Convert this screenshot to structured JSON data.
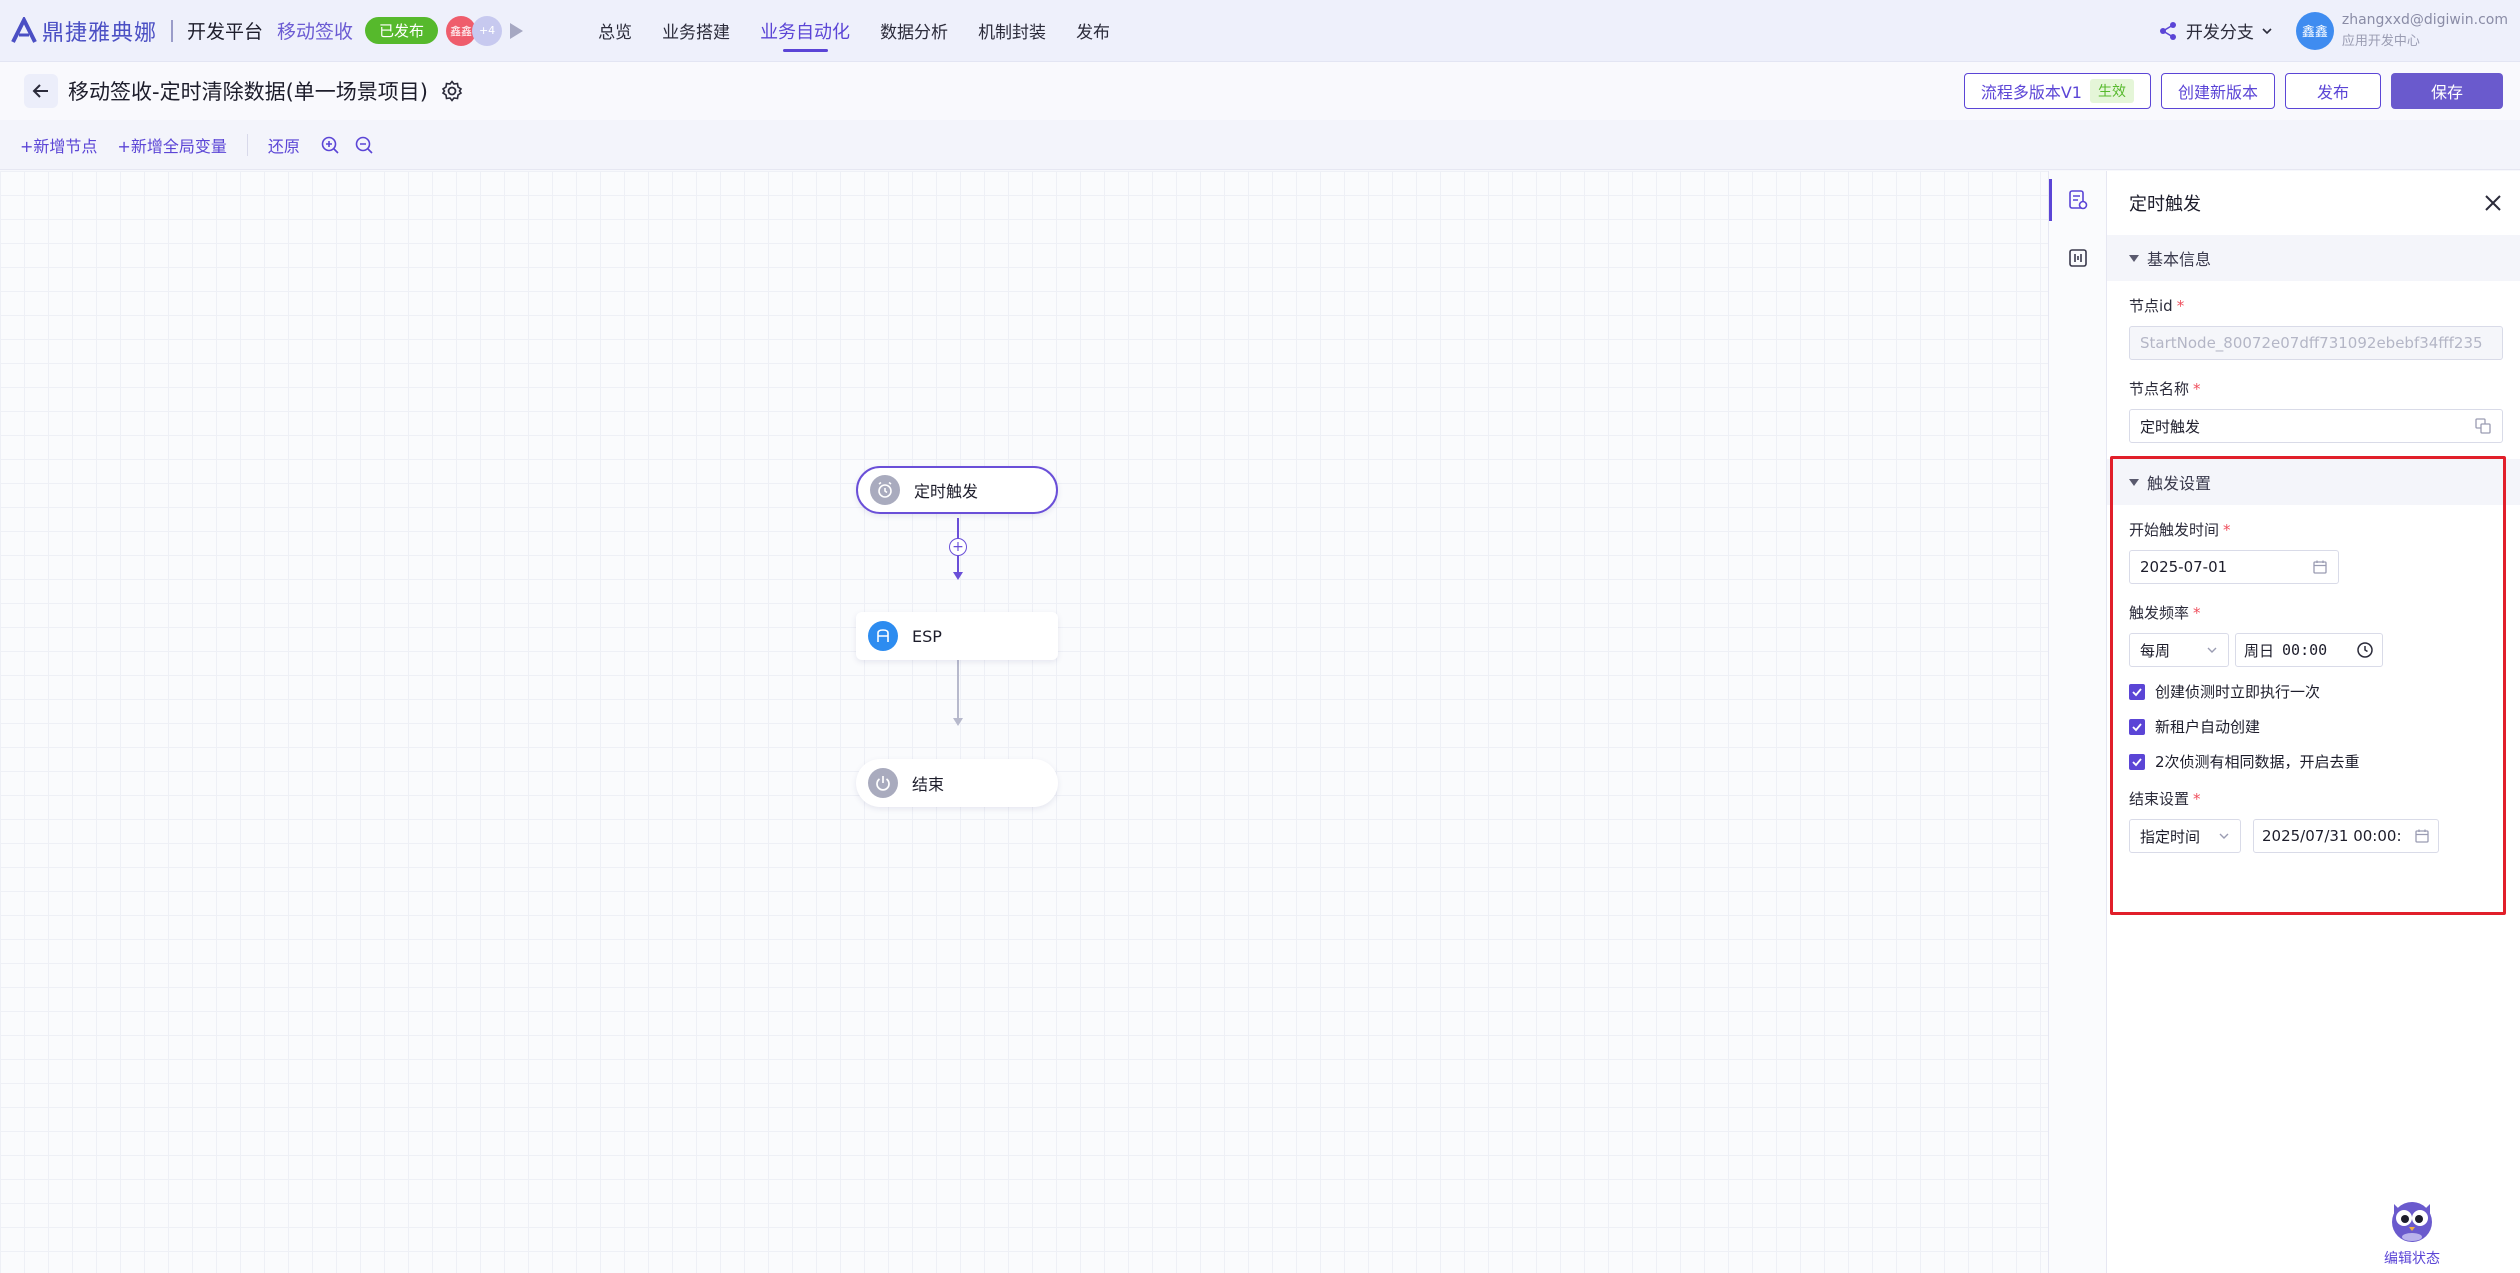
{
  "header": {
    "logo_text": "鼎捷雅典娜",
    "platform": "开发平台",
    "app_name": "移动签收",
    "status_badge": "已发布",
    "avatar_1": "鑫鑫",
    "avatar_more": "+4",
    "nav": [
      "总览",
      "业务搭建",
      "业务自动化",
      "数据分析",
      "机制封装",
      "发布"
    ],
    "active_nav": "业务自动化",
    "branch": "开发分支",
    "user_avatar": "鑫鑫",
    "user_email": "zhangxxd@digiwin.com",
    "user_org": "应用开发中心"
  },
  "titlebar": {
    "title": "移动签收-定时清除数据(单一场景项目)",
    "version_button": "流程多版本V1",
    "version_tag": "生效",
    "new_version_button": "创建新版本",
    "publish_button": "发布",
    "save_button": "保存"
  },
  "toolbar": {
    "add_node": "+新增节点",
    "add_global_var": "+新增全局变量",
    "restore": "还原"
  },
  "flow": {
    "nodes": [
      {
        "label": "定时触发",
        "icon": "alarm-clock-icon"
      },
      {
        "label": "ESP",
        "icon": "esp-icon"
      },
      {
        "label": "结束",
        "icon": "power-icon"
      }
    ]
  },
  "panel": {
    "title": "定时触发",
    "basic_section": "基本信息",
    "node_id_label": "节点id",
    "node_id_value": "StartNode_80072e07dff731092ebebf34fff235",
    "node_name_label": "节点名称",
    "node_name_value": "定时触发",
    "trigger_section": "触发设置",
    "start_time_label": "开始触发时间",
    "start_time_value": "2025-07-01",
    "frequency_label": "触发频率",
    "frequency_value": "每周",
    "weekday_value": "周日",
    "time_value": "00:00",
    "check_1": "创建侦测时立即执行一次",
    "check_2": "新租户自动创建",
    "check_3": "2次侦测有相同数据，开启去重",
    "end_label": "结束设置",
    "end_mode_value": "指定时间",
    "end_time_value": "2025/07/31 00:00:"
  },
  "mascot_label": "编辑状态",
  "colors": {
    "accent": "#5b45d6",
    "published": "#56b92c",
    "highlight": "#e11f2a"
  }
}
